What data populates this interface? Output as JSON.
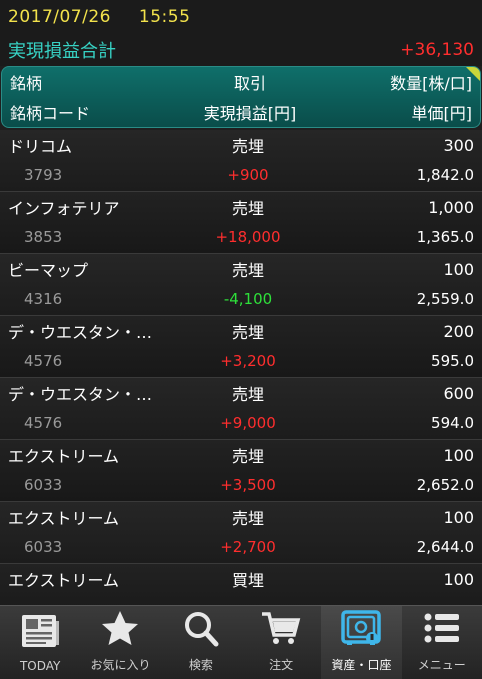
{
  "header": {
    "date": "2017/07/26",
    "time": "15:55"
  },
  "summary": {
    "label": "実現損益合計",
    "value": "+36,130"
  },
  "columns": {
    "name": "銘柄",
    "trade": "取引",
    "quantity": "数量[株/口]",
    "code": "銘柄コード",
    "pl": "実現損益[円]",
    "price": "単価[円]"
  },
  "rows": [
    {
      "name": "ドリコム",
      "trade": "売埋",
      "quantity": "300",
      "code": "3793",
      "pl": "+900",
      "price": "1,842.0"
    },
    {
      "name": "インフォテリア",
      "trade": "売埋",
      "quantity": "1,000",
      "code": "3853",
      "pl": "+18,000",
      "price": "1,365.0"
    },
    {
      "name": "ビーマップ",
      "trade": "売埋",
      "quantity": "100",
      "code": "4316",
      "pl": "-4,100",
      "price": "2,559.0"
    },
    {
      "name": "デ・ウエスタン・…",
      "trade": "売埋",
      "quantity": "200",
      "code": "4576",
      "pl": "+3,200",
      "price": "595.0"
    },
    {
      "name": "デ・ウエスタン・…",
      "trade": "売埋",
      "quantity": "600",
      "code": "4576",
      "pl": "+9,000",
      "price": "594.0"
    },
    {
      "name": "エクストリーム",
      "trade": "売埋",
      "quantity": "100",
      "code": "6033",
      "pl": "+3,500",
      "price": "2,652.0"
    },
    {
      "name": "エクストリーム",
      "trade": "売埋",
      "quantity": "100",
      "code": "6033",
      "pl": "+2,700",
      "price": "2,644.0"
    },
    {
      "name": "エクストリーム",
      "trade": "買埋",
      "quantity": "100",
      "code": "",
      "pl": "",
      "price": ""
    }
  ],
  "nav": [
    {
      "label": "TODAY",
      "icon": "newspaper-icon"
    },
    {
      "label": "お気に入り",
      "icon": "star-icon"
    },
    {
      "label": "検索",
      "icon": "search-icon"
    },
    {
      "label": "注文",
      "icon": "cart-icon"
    },
    {
      "label": "資産・口座",
      "icon": "safe-icon",
      "active": true
    },
    {
      "label": "メニュー",
      "icon": "menu-icon"
    }
  ],
  "colors": {
    "accent": "#37d2c4",
    "positive": "#ff2e2e",
    "negative": "#2ee03a",
    "date": "#f2e24c"
  }
}
